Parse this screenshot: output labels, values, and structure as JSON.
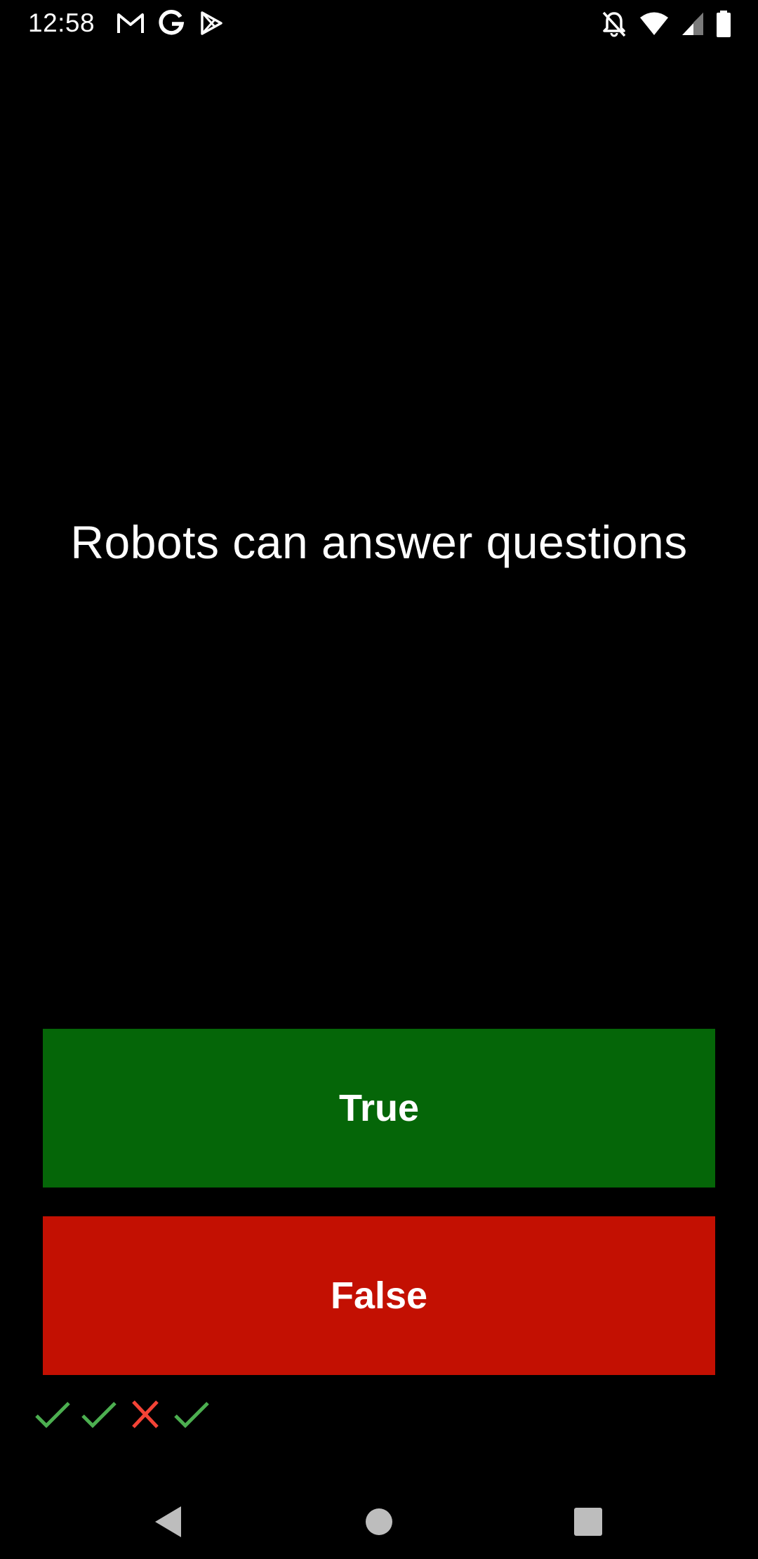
{
  "status_bar": {
    "time": "12:58",
    "left_icons": [
      "gmail-icon",
      "google-icon",
      "play-store-icon"
    ],
    "right_icons": [
      "notifications-off-icon",
      "wifi-icon",
      "cell-signal-icon",
      "battery-icon"
    ]
  },
  "question": {
    "text": "Robots can answer questions"
  },
  "answers": {
    "true_label": "True",
    "false_label": "False",
    "true_color": "#056608",
    "false_color": "#C31002"
  },
  "score_keeper": {
    "results": [
      "correct",
      "correct",
      "incorrect",
      "correct"
    ],
    "correct_color": "#4CAF50",
    "incorrect_color": "#F44336"
  },
  "nav_bar": {
    "buttons": [
      "back-icon",
      "home-icon",
      "recents-icon"
    ],
    "icon_color": "#BDBDBD"
  }
}
